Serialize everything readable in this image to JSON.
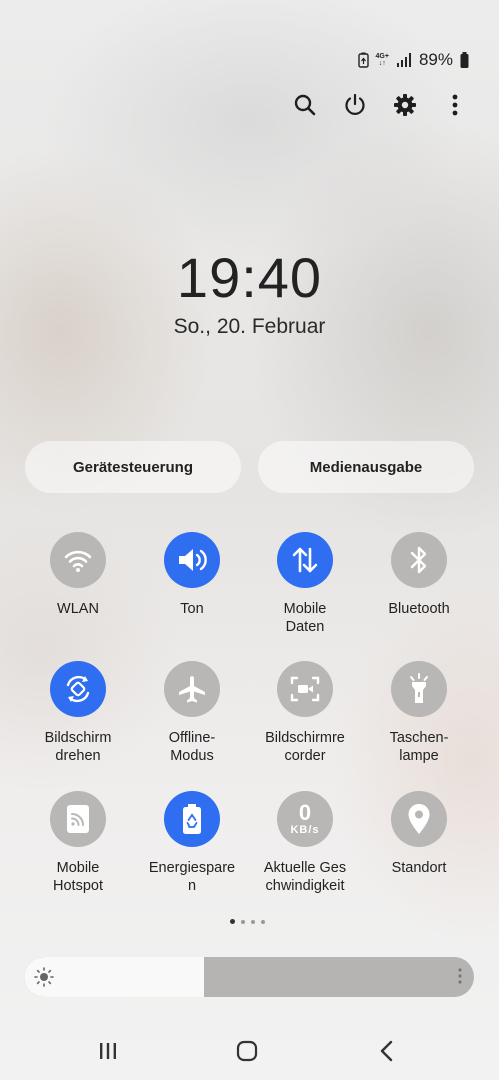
{
  "status_bar": {
    "battery_percent": "89%",
    "network": "4G+",
    "icons": [
      "power-saving-icon",
      "network-4g-icon",
      "signal-icon",
      "battery-icon"
    ]
  },
  "top_actions": [
    "search-icon",
    "power-icon",
    "gear-icon",
    "more-vert-icon"
  ],
  "clock": {
    "time": "19:40",
    "date": "So., 20. Februar"
  },
  "controls": {
    "device_control": "Gerätesteuerung",
    "media_output": "Medienausgabe"
  },
  "tiles": [
    {
      "id": "wlan",
      "label": "WLAN",
      "active": false,
      "icon": "wifi-icon"
    },
    {
      "id": "sound",
      "label": "Ton",
      "active": true,
      "icon": "speaker-icon"
    },
    {
      "id": "mobile-data",
      "label": "Mobile\nDaten",
      "active": true,
      "icon": "data-arrows-icon"
    },
    {
      "id": "bluetooth",
      "label": "Bluetooth",
      "active": false,
      "icon": "bluetooth-icon"
    },
    {
      "id": "rotate",
      "label": "Bildschirm\ndrehen",
      "active": true,
      "icon": "rotate-icon"
    },
    {
      "id": "airplane",
      "label": "Offline-\nModus",
      "active": false,
      "icon": "airplane-icon"
    },
    {
      "id": "screen-recorder",
      "label": "Bildschirmre\ncorder",
      "active": false,
      "icon": "screen-recorder-icon"
    },
    {
      "id": "flashlight",
      "label": "Taschen-\nlampe",
      "active": false,
      "icon": "flashlight-icon"
    },
    {
      "id": "hotspot",
      "label": "Mobile\nHotspot",
      "active": false,
      "icon": "hotspot-icon"
    },
    {
      "id": "power-saving",
      "label": "Energiespare\nn",
      "active": true,
      "icon": "battery-recycle-icon"
    },
    {
      "id": "net-speed",
      "label": "Aktuelle Ges\nchwindigkeit",
      "active": false,
      "icon": "speed-icon",
      "speed_value": "0",
      "speed_unit": "KB/s"
    },
    {
      "id": "location",
      "label": "Standort",
      "active": false,
      "icon": "location-pin-icon"
    }
  ],
  "pagination": {
    "pages": 4,
    "current": 1
  },
  "brightness": {
    "level": 0.4
  },
  "navbar": [
    "recent-apps-icon",
    "home-icon",
    "back-icon"
  ],
  "colors": {
    "active": "#2f6ef0",
    "inactive": "#b9b7b5"
  }
}
